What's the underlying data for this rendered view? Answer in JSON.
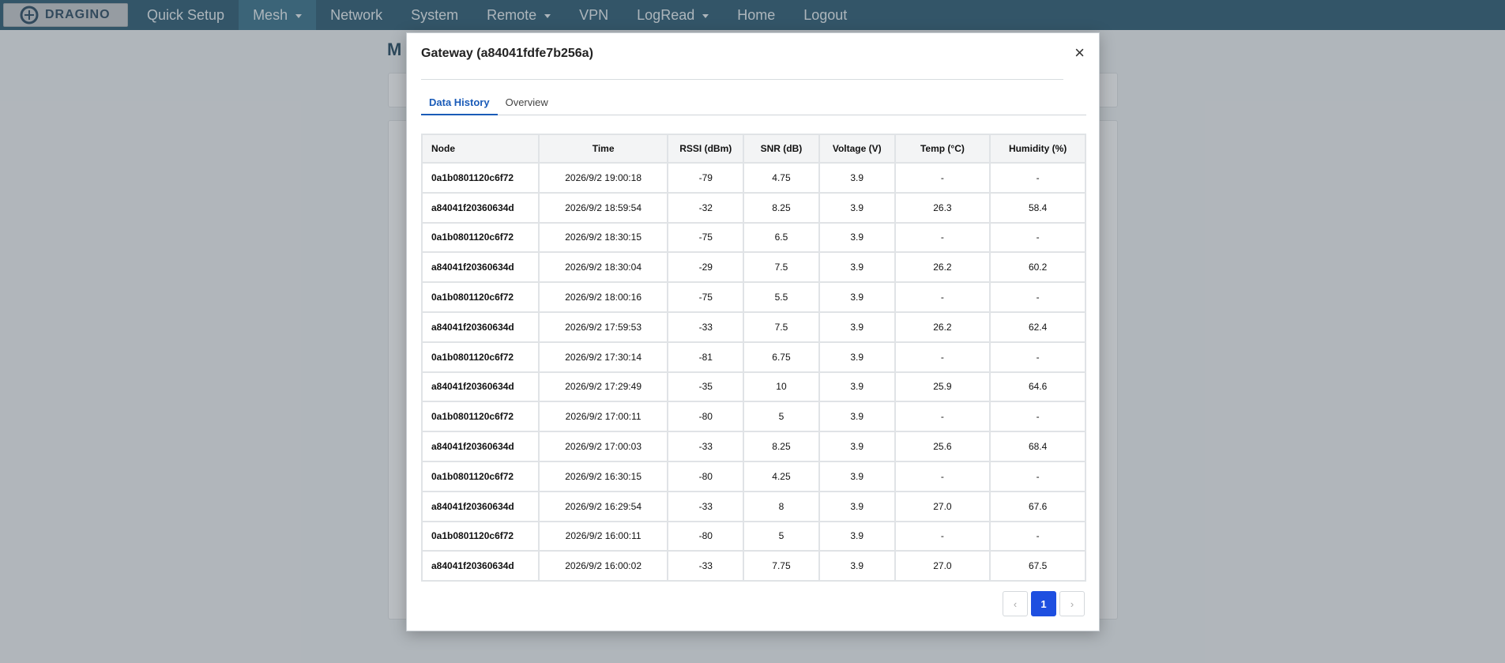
{
  "navbar": {
    "logo_text": "DRAGINO",
    "items": [
      {
        "label": "Quick Setup"
      },
      {
        "label": "Mesh"
      },
      {
        "label": "Network"
      },
      {
        "label": "System"
      },
      {
        "label": "Remote"
      },
      {
        "label": "VPN"
      },
      {
        "label": "LogRead"
      },
      {
        "label": "Home"
      },
      {
        "label": "Logout"
      }
    ]
  },
  "background": {
    "title_fragment": "M"
  },
  "modal": {
    "title": "Gateway (a84041fdfe7b256a)",
    "close_glyph": "×",
    "tabs": [
      {
        "label": "Data History"
      },
      {
        "label": "Overview"
      }
    ],
    "table": {
      "headers": [
        "Node",
        "Time",
        "RSSI (dBm)",
        "SNR (dB)",
        "Voltage (V)",
        "Temp (°C)",
        "Humidity (%)"
      ],
      "rows": [
        [
          "0a1b0801120c6f72",
          "2026/9/2 19:00:18",
          "-79",
          "4.75",
          "3.9",
          "-",
          "-"
        ],
        [
          "a84041f20360634d",
          "2026/9/2 18:59:54",
          "-32",
          "8.25",
          "3.9",
          "26.3",
          "58.4"
        ],
        [
          "0a1b0801120c6f72",
          "2026/9/2 18:30:15",
          "-75",
          "6.5",
          "3.9",
          "-",
          "-"
        ],
        [
          "a84041f20360634d",
          "2026/9/2 18:30:04",
          "-29",
          "7.5",
          "3.9",
          "26.2",
          "60.2"
        ],
        [
          "0a1b0801120c6f72",
          "2026/9/2 18:00:16",
          "-75",
          "5.5",
          "3.9",
          "-",
          "-"
        ],
        [
          "a84041f20360634d",
          "2026/9/2 17:59:53",
          "-33",
          "7.5",
          "3.9",
          "26.2",
          "62.4"
        ],
        [
          "0a1b0801120c6f72",
          "2026/9/2 17:30:14",
          "-81",
          "6.75",
          "3.9",
          "-",
          "-"
        ],
        [
          "a84041f20360634d",
          "2026/9/2 17:29:49",
          "-35",
          "10",
          "3.9",
          "25.9",
          "64.6"
        ],
        [
          "0a1b0801120c6f72",
          "2026/9/2 17:00:11",
          "-80",
          "5",
          "3.9",
          "-",
          "-"
        ],
        [
          "a84041f20360634d",
          "2026/9/2 17:00:03",
          "-33",
          "8.25",
          "3.9",
          "25.6",
          "68.4"
        ],
        [
          "0a1b0801120c6f72",
          "2026/9/2 16:30:15",
          "-80",
          "4.25",
          "3.9",
          "-",
          "-"
        ],
        [
          "a84041f20360634d",
          "2026/9/2 16:29:54",
          "-33",
          "8",
          "3.9",
          "27.0",
          "67.6"
        ],
        [
          "0a1b0801120c6f72",
          "2026/9/2 16:00:11",
          "-80",
          "5",
          "3.9",
          "-",
          "-"
        ],
        [
          "a84041f20360634d",
          "2026/9/2 16:00:02",
          "-33",
          "7.75",
          "3.9",
          "27.0",
          "67.5"
        ]
      ]
    },
    "pagination": {
      "prev_glyph": "‹",
      "current_page": "1",
      "next_glyph": "›"
    }
  },
  "colors": {
    "navbar_bg": "#1f4f67",
    "accent_blue": "#1e4fe0",
    "tab_active": "#1a5bb8"
  }
}
